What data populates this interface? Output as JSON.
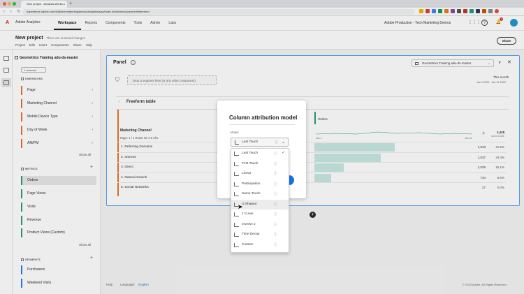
{
  "browser": {
    "tab_title": "New project - Analysis Works...",
    "tab_close": "×",
    "new_tab": "+",
    "nav_glyphs": "‹ › ↻",
    "url": "experience.adobe.com/#/@techmarketingdemos/analytics/spa/index.html#/workspace/edit/freeform"
  },
  "app": {
    "logo_glyph": "A",
    "product": "Adobe Analytics",
    "nav": [
      "Workspace",
      "Reports",
      "Components",
      "Tools",
      "Admin",
      "Labs"
    ],
    "active_nav": "Workspace",
    "org": "Adobe Production - Tech Marketing Demos",
    "help_glyph": "?",
    "bell_glyph": "🔔",
    "bell_count": "1",
    "apps_glyph": "⋮⋮⋮"
  },
  "project": {
    "title": "New project",
    "status": "There are unsaved changes",
    "menu": [
      "Project",
      "Edit",
      "Insert",
      "Components",
      "Share",
      "Help"
    ],
    "share_label": "Share"
  },
  "sidebar": {
    "report_suite": "Geometrixx Training adu-ds-master",
    "select_label": "1 selected",
    "dimensions_header": "DIMENSIONS",
    "dimensions": [
      "Page",
      "Marketing Channel",
      "Mobile Device Type",
      "Day of Week",
      "AM/PM"
    ],
    "metrics_header": "METRICS",
    "metrics": [
      "Orders",
      "Page Views",
      "Visits",
      "Revenue",
      "Product Views (Custom)"
    ],
    "segments_header": "SEGMENTS",
    "segments": [
      "Purchasers",
      "Weekend Visits"
    ],
    "show_all": "Show all",
    "plus": "+",
    "chevron": "›"
  },
  "panel": {
    "title": "Panel",
    "info": "i",
    "report_suite_dropdown": "Geometrixx Training adu-ds-master",
    "dropdown_chevron": "⌄",
    "collapse_glyph": "∨",
    "close_glyph": "✕",
    "filter_glyph": "⛉",
    "dropzone": "Drop a segment here (or any other component)",
    "date_label": "This month",
    "date_range": "Jan 1 2023 - Jan 31 2023"
  },
  "table": {
    "chevron": "›",
    "title": "Freeform table",
    "dimension_header": "Marketing Channel",
    "pagination": "Page: 1 / 1   Rows: 50   1-5 of 5",
    "metric_header": "Orders",
    "spark_start": "Jan 1",
    "spark_end": "Jan 31",
    "plus": "+",
    "total_value": "2,425",
    "total_pct": "out of 2,425",
    "rows": [
      {
        "label": "1. Referring Domains",
        "value": "1,010",
        "pct": "41.6%",
        "share": 0.416
      },
      {
        "label": "2. Internet",
        "value": "1,037",
        "pct": "34.4%",
        "share": 0.344
      },
      {
        "label": "3. Direct",
        "value": "1,026",
        "pct": "15.1%",
        "share": 0.151
      },
      {
        "label": "4. Natural Search",
        "value": "734",
        "pct": "8.6%",
        "share": 0.086
      },
      {
        "label": "5. Social Networks",
        "value": "27",
        "pct": "0.0%",
        "share": 0.0
      }
    ]
  },
  "add_panel_glyph": "+",
  "footer": {
    "help": "Help",
    "language_label": "Language:",
    "language_value": "English",
    "copyright": "© 2023 Adobe. All Rights Reserved."
  },
  "modal": {
    "title": "Column attribution model",
    "model_label": "Model",
    "selected_model": "Last Touch",
    "info_glyph": "ⓘ",
    "chevron": "⌄",
    "check_glyph": "✓",
    "cursor_glyph": "➤",
    "options": [
      "Last Touch",
      "First Touch",
      "Linear",
      "Participation",
      "Same Touch",
      "U Shaped",
      "J Curve",
      "Inverse J",
      "Time Decay",
      "Custom"
    ],
    "hovered_option": "U Shaped"
  },
  "colors": {
    "accent_blue": "#1473e6",
    "dimension_orange": "#e8742c",
    "metric_green": "#2d9d78",
    "segment_blue": "#2680eb",
    "bar_fill": "#c9e9e2",
    "adobe_red": "#eb1000"
  }
}
